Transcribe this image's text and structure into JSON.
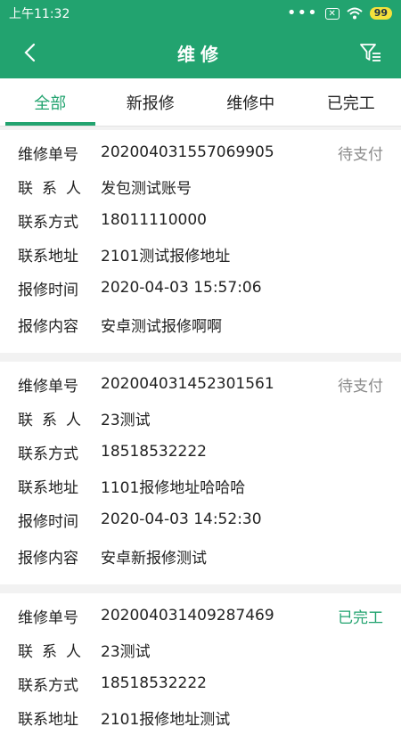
{
  "statusbar": {
    "time": "上午11:32",
    "battery": "99"
  },
  "appbar": {
    "title": "维修"
  },
  "tabs": [
    {
      "label": "全部"
    },
    {
      "label": "新报修"
    },
    {
      "label": "维修中"
    },
    {
      "label": "已完工"
    }
  ],
  "labels": {
    "order_no": "维修单号",
    "contact": "联系人",
    "phone": "联系方式",
    "address": "联系地址",
    "time": "报修时间",
    "content": "报修内容"
  },
  "orders": [
    {
      "order_no": "202004031557069905",
      "status": "待支付",
      "contact": "发包测试账号",
      "phone": "18011110000",
      "address": "2101测试报修地址",
      "time": "2020-04-03 15:57:06",
      "content": "安卓测试报修啊啊"
    },
    {
      "order_no": "202004031452301561",
      "status": "待支付",
      "contact": "23测试",
      "phone": "18518532222",
      "address": "1101报修地址哈哈哈",
      "time": "2020-04-03 14:52:30",
      "content": "安卓新报修测试"
    },
    {
      "order_no": "202004031409287469",
      "status": "已完工",
      "contact": "23测试",
      "phone": "18518532222",
      "address": "2101报修地址测试"
    }
  ],
  "colors": {
    "brand": "#22a36f",
    "pending": "#8a8a8a"
  }
}
